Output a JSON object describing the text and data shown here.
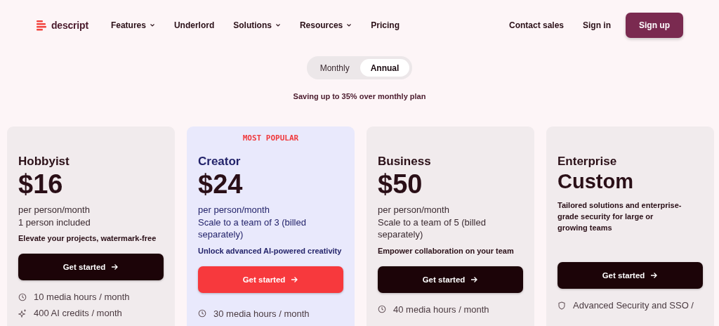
{
  "nav": {
    "logo": "descript",
    "links": [
      {
        "label": "Features",
        "dropdown": true
      },
      {
        "label": "Underlord",
        "dropdown": false
      },
      {
        "label": "Solutions",
        "dropdown": true
      },
      {
        "label": "Resources",
        "dropdown": true
      },
      {
        "label": "Pricing",
        "dropdown": false
      }
    ],
    "right_links": [
      "Contact sales",
      "Sign in"
    ],
    "cta": "Sign up"
  },
  "billing_toggle": [
    {
      "label": "Monthly",
      "selected": false
    },
    {
      "label": "Annual",
      "selected": true
    }
  ],
  "savings_note": "Saving up to 35% over monthly plan",
  "plans": [
    {
      "name": "Hobbyist",
      "price": "$16",
      "kind": "standard",
      "highlighted": false,
      "lines": [
        "per person/month",
        "1 person included"
      ],
      "tagline": "Elevate your projects, watermark-free",
      "button": "Get started",
      "features": [
        {
          "kind": "clock",
          "text": "10 media hours / month"
        },
        {
          "kind": "sparkle",
          "text": "400 AI credits / month"
        }
      ]
    },
    {
      "name": "Creator",
      "badge": "MOST POPULAR",
      "price": "$24",
      "kind": "standard",
      "highlighted": true,
      "lines": [
        "per person/month",
        "Scale to a team of 3 (billed separately)"
      ],
      "tagline": "Unlock advanced AI-powered creativity",
      "button": "Get started",
      "features": [
        {
          "kind": "clock",
          "text": "30 media hours / month"
        }
      ]
    },
    {
      "name": "Business",
      "price": "$50",
      "kind": "standard",
      "highlighted": false,
      "lines": [
        "per person/month",
        "Scale to a team of 5 (billed separately)"
      ],
      "tagline": "Empower collaboration on your team",
      "button": "Get started",
      "features": [
        {
          "kind": "clock",
          "text": "40 media hours / month"
        }
      ]
    },
    {
      "name": "Enterprise",
      "price": "Custom",
      "kind": "custom",
      "highlighted": false,
      "tagline": "Tailored solutions and enterprise-grade security for large or growing teams",
      "button": "Get started",
      "features": [
        {
          "kind": "shield",
          "text": "Advanced Security and SSO /"
        }
      ]
    }
  ]
}
